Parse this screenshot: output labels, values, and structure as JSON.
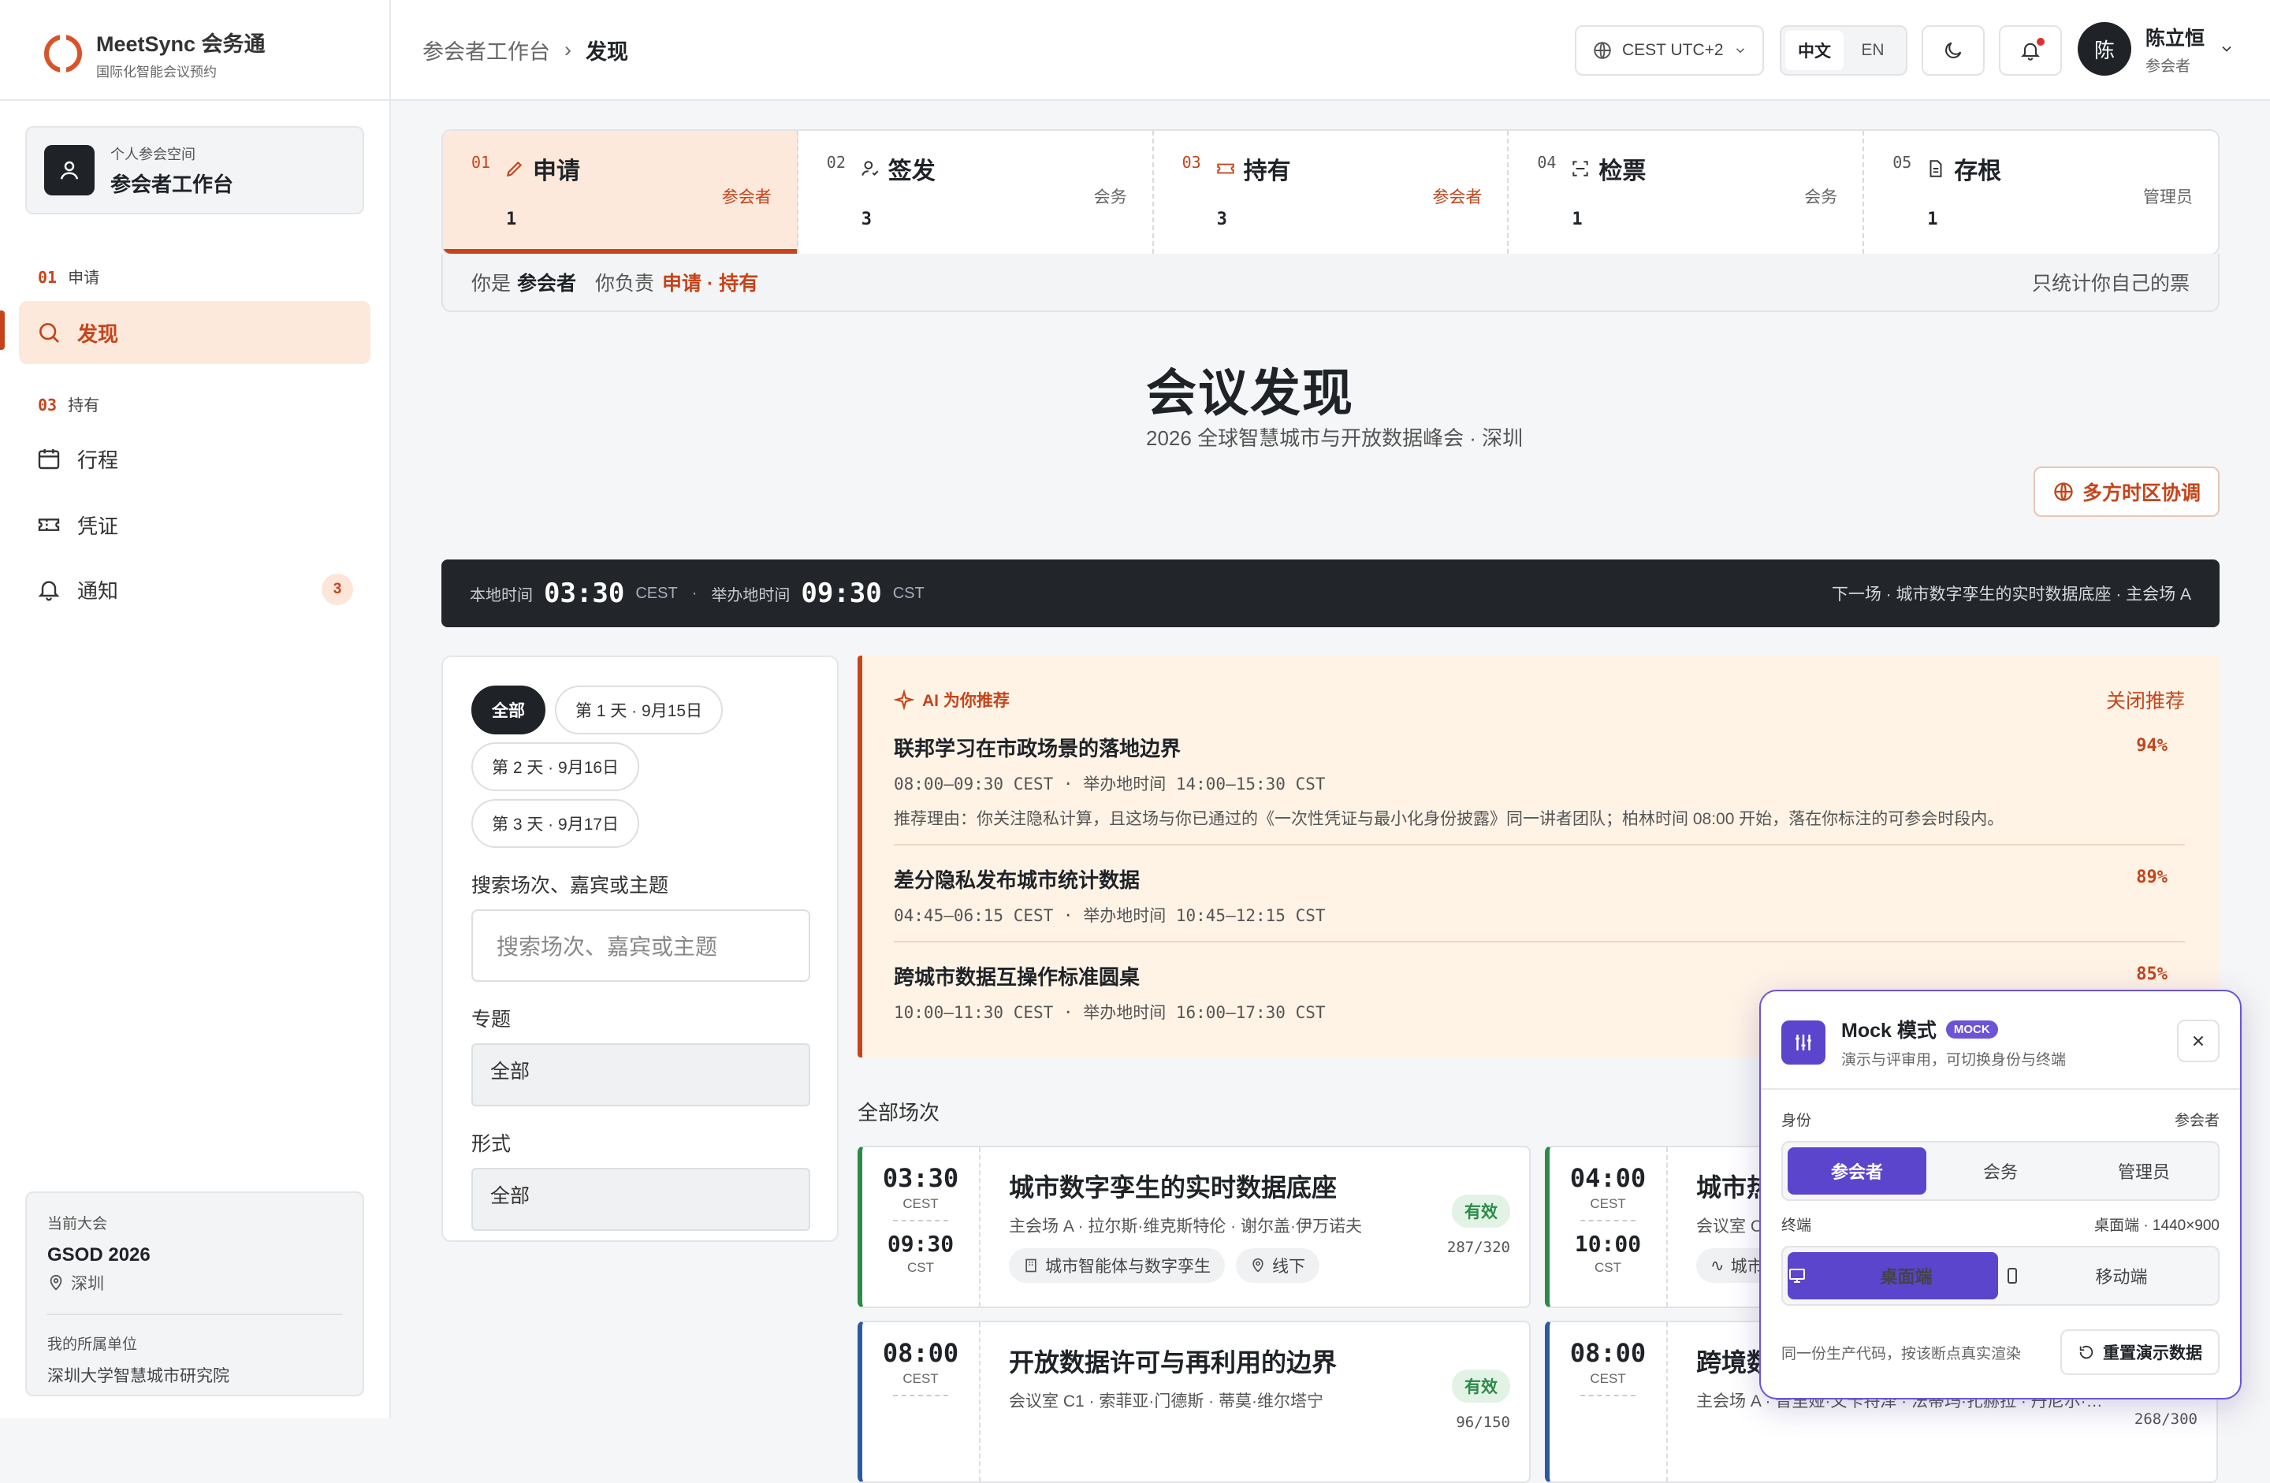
{
  "app": {
    "name": "MeetSync 会务通",
    "tagline": "国际化智能会议预约"
  },
  "sidebar": {
    "workspace": {
      "label": "个人参会空间",
      "title": "参会者工作台"
    },
    "sections": [
      {
        "num": "01",
        "label": "申请"
      },
      {
        "num": "03",
        "label": "持有"
      }
    ],
    "items": [
      {
        "label": "发现",
        "icon": "search-icon",
        "active": true
      },
      {
        "label": "行程",
        "icon": "calendar-icon"
      },
      {
        "label": "凭证",
        "icon": "ticket-icon"
      },
      {
        "label": "通知",
        "icon": "bell-icon",
        "count": "3"
      }
    ],
    "conference": {
      "label": "当前大会",
      "name": "GSOD 2026",
      "city": "深圳",
      "org_label": "我的所属单位",
      "org": "深圳大学智慧城市研究院"
    }
  },
  "topbar": {
    "breadcrumb": [
      "参会者工作台",
      "发现"
    ],
    "timezone": "CEST UTC+2",
    "languages": [
      "中文",
      "EN"
    ],
    "active_language": "中文",
    "user": {
      "initial": "陈",
      "name": "陈立恒",
      "role": "参会者"
    }
  },
  "steps": [
    {
      "num": "01",
      "title": "申请",
      "role": "参会者",
      "count": "1",
      "icon": "pencil-icon",
      "active": true
    },
    {
      "num": "02",
      "title": "签发",
      "role": "会务",
      "count": "3",
      "icon": "user-check-icon"
    },
    {
      "num": "03",
      "title": "持有",
      "role": "参会者",
      "count": "3",
      "icon": "ticket-icon",
      "highlight": true
    },
    {
      "num": "04",
      "title": "检票",
      "role": "会务",
      "count": "1",
      "icon": "scan-icon"
    },
    {
      "num": "05",
      "title": "存根",
      "role": "管理员",
      "count": "1",
      "icon": "file-icon"
    }
  ],
  "rolebar": {
    "you_are": "你是",
    "role": "参会者",
    "responsible": "你负责",
    "duties": "申请 · 持有",
    "note": "只统计你自己的票"
  },
  "page": {
    "title": "会议发现",
    "subtitle": "2026 全球智慧城市与开放数据峰会 · 深圳",
    "multi_tz_button": "多方时区协调"
  },
  "clock": {
    "local_label": "本地时间",
    "local_time": "03:30",
    "local_tz": "CEST",
    "host_label": "举办地时间",
    "host_time": "09:30",
    "host_tz": "CST",
    "next": "下一场 · 城市数字孪生的实时数据底座 · 主会场 A"
  },
  "filters": {
    "days": [
      "全部",
      "第 1 天 · 9月15日",
      "第 2 天 · 9月16日",
      "第 3 天 · 9月17日"
    ],
    "active_day": "全部",
    "search_label": "搜索场次、嘉宾或主题",
    "search_placeholder": "搜索场次、嘉宾或主题",
    "topic_label": "专题",
    "topic_value": "全部",
    "format_label": "形式",
    "format_value": "全部"
  },
  "recommend": {
    "header": "AI 为你推荐",
    "close": "关闭推荐",
    "items": [
      {
        "title": "联邦学习在市政场景的落地边界",
        "time": "08:00–09:30 CEST · 举办地时间 14:00–15:30 CST",
        "reason": "推荐理由：你关注隐私计算，且这场与你已通过的《一次性凭证与最小化身份披露》同一讲者团队；柏林时间 08:00 开始，落在你标注的可参会时段内。",
        "score": "94%"
      },
      {
        "title": "差分隐私发布城市统计数据",
        "time": "04:45–06:15 CEST · 举办地时间 10:45–12:15 CST",
        "score": "89%"
      },
      {
        "title": "跨城市数据互操作标准圆桌",
        "time": "10:00–11:30 CEST · 举办地时间 16:00–17:30 CST",
        "score": "85%"
      }
    ]
  },
  "sessions": {
    "header": "全部场次",
    "cards": [
      {
        "start": "03:30",
        "start_tz": "CEST",
        "end": "09:30",
        "end_tz": "CST",
        "title": "城市数字孪生的实时数据底座",
        "meta": "主会场 A · 拉尔斯·维克斯特伦 · 谢尔盖·伊万诺夫",
        "tags": [
          "城市智能体与数字孪生",
          "线下"
        ],
        "status": "有效",
        "capacity": "287/320"
      },
      {
        "start": "04:00",
        "start_tz": "CEST",
        "end": "10:00",
        "end_tz": "CST",
        "title": "城市热",
        "meta": "会议室 C",
        "tags": [
          "城市"
        ],
        "status": "",
        "capacity": ""
      },
      {
        "start": "08:00",
        "start_tz": "CEST",
        "end": "",
        "end_tz": "",
        "title": "开放数据许可与再利用的边界",
        "meta": "会议室 C1 · 索菲亚·门德斯 · 蒂莫·维尔塔宁",
        "tags": [],
        "status": "有效",
        "capacity": "96/150"
      },
      {
        "start": "08:00",
        "start_tz": "CEST",
        "end": "",
        "end_tz": "",
        "title": "跨境数",
        "meta": "主会场 A · 普里娅·文卡特泽 · 法蒂玛·扎赫拉 · 丹尼尔·…",
        "tags": [],
        "status": "",
        "capacity": "268/300"
      }
    ]
  },
  "mock": {
    "title": "Mock 模式",
    "tag": "MOCK",
    "subtitle": "演示与评审用，可切换身份与终端",
    "identity_label": "身份",
    "identity_value": "参会者",
    "identities": [
      "参会者",
      "会务",
      "管理员"
    ],
    "terminal_label": "终端",
    "terminal_value": "桌面端 · 1440×900",
    "terminals": [
      "桌面端",
      "移动端"
    ],
    "footer": "同一份生产代码，按该断点真实渲染",
    "reset": "重置演示数据"
  },
  "colors": {
    "accent": "#c6441b",
    "dark": "#1f2328",
    "mock": "#5a45cc",
    "valid": "#2d8a48"
  }
}
